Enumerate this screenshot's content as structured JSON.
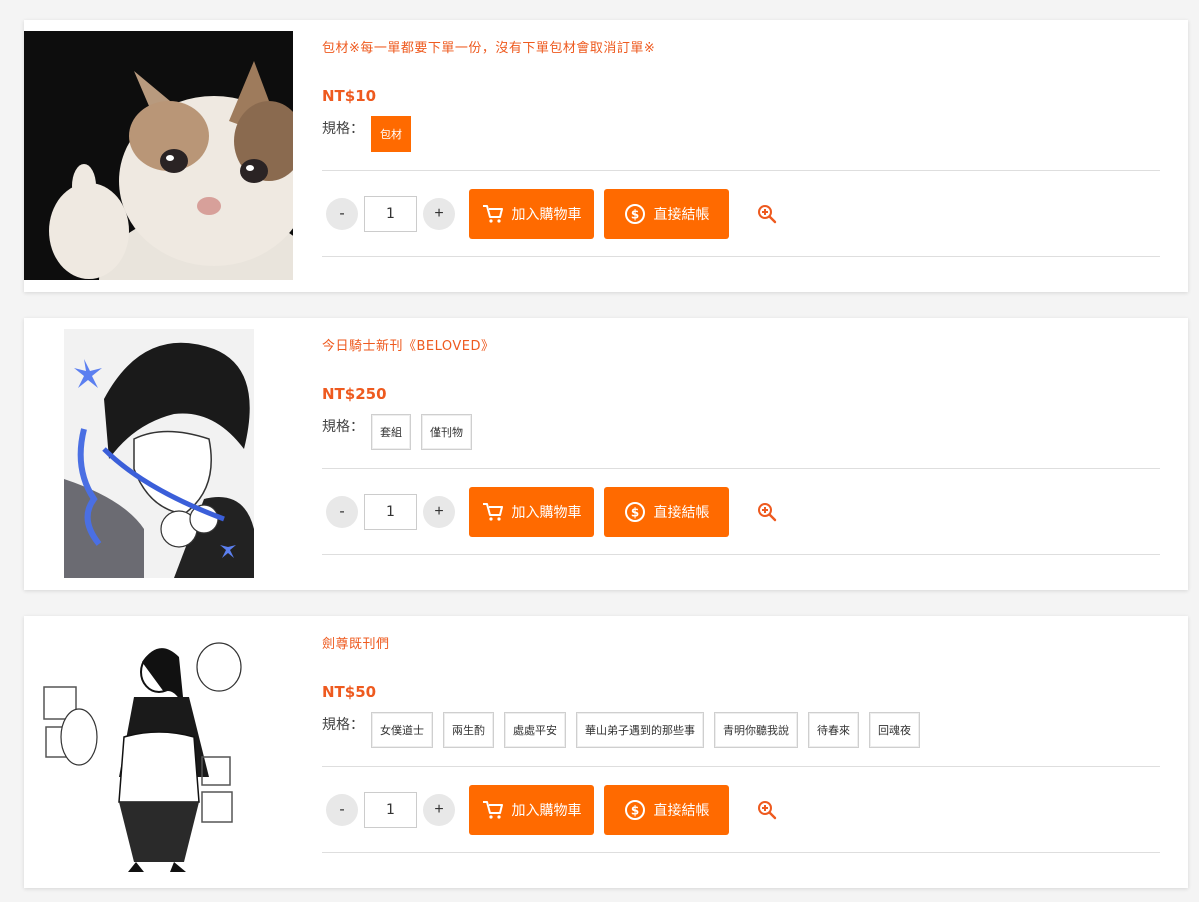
{
  "colors": {
    "accent": "#ff6a00",
    "title": "#ee5a1f"
  },
  "products": [
    {
      "name": "包材※每一單都要下單一份，沒有下單包材會取消訂單※",
      "price": "NT$10",
      "spec_label": "規格：",
      "options": [
        {
          "label": "包材",
          "selected": true
        }
      ],
      "qty": "1",
      "image": "crying-cat-thumbs-up"
    },
    {
      "name": "今日騎士新刊《BELOVED》",
      "price": "NT$250",
      "spec_label": "規格：",
      "options": [
        {
          "label": "套組",
          "selected": false
        },
        {
          "label": "僅刊物",
          "selected": false
        }
      ],
      "qty": "1",
      "image": "manga-cover-dark-haired-man"
    },
    {
      "name": "劍尊既刊們",
      "price": "NT$50",
      "spec_label": "規格：",
      "options": [
        {
          "label": "女僕道士",
          "selected": false
        },
        {
          "label": "兩生酌",
          "selected": false
        },
        {
          "label": "處處平安",
          "selected": false
        },
        {
          "label": "華山弟子遇到的那些事",
          "selected": false
        },
        {
          "label": "青明你聽我說",
          "selected": false
        },
        {
          "label": "待春來",
          "selected": false
        },
        {
          "label": "回魂夜",
          "selected": false
        }
      ],
      "qty": "1",
      "image": "maid-taoist-manga-lineart"
    }
  ],
  "buttons": {
    "minus": "-",
    "plus": "+",
    "add_to_cart": "加入購物車",
    "checkout": "直接結帳"
  },
  "icons": {
    "cart": "cart-icon",
    "checkout": "dollar-coin-icon",
    "zoom": "zoom-in-icon"
  }
}
